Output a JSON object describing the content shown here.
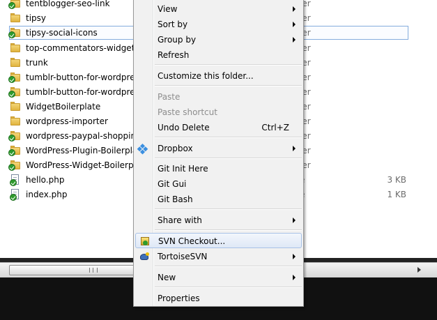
{
  "files": [
    {
      "name": "tentblogger-seo-link",
      "icon": "folder-svn-icon",
      "type": "ler",
      "size": ""
    },
    {
      "name": "tipsy",
      "icon": "folder-icon",
      "type": "ler",
      "size": ""
    },
    {
      "name": "tipsy-social-icons",
      "icon": "folder-svn-icon",
      "type": "ler",
      "size": ""
    },
    {
      "name": "top-commentators-widget",
      "icon": "folder-icon",
      "type": "ler",
      "size": ""
    },
    {
      "name": "trunk",
      "icon": "folder-icon",
      "type": "ler",
      "size": ""
    },
    {
      "name": "tumblr-button-for-wordpress",
      "icon": "folder-svn-icon",
      "type": "ler",
      "size": ""
    },
    {
      "name": "tumblr-button-for-wordpress",
      "icon": "folder-svn-icon",
      "type": "ler",
      "size": ""
    },
    {
      "name": "WidgetBoilerplate",
      "icon": "folder-icon",
      "type": "ler",
      "size": ""
    },
    {
      "name": "wordpress-importer",
      "icon": "folder-icon",
      "type": "ler",
      "size": ""
    },
    {
      "name": "wordpress-paypal-shopping-",
      "icon": "folder-svn-icon",
      "type": "ler",
      "size": ""
    },
    {
      "name": "WordPress-Plugin-Boilerplate",
      "icon": "folder-svn-icon",
      "type": "ler",
      "size": ""
    },
    {
      "name": "WordPress-Widget-Boilerplat",
      "icon": "folder-svn-icon",
      "type": "ler",
      "size": ""
    },
    {
      "name": "hello.php",
      "icon": "php-file-icon",
      "type": "e",
      "size": "3 KB"
    },
    {
      "name": "index.php",
      "icon": "php-file-icon",
      "type": "e",
      "size": "1 KB"
    }
  ],
  "context_menu": {
    "view": "View",
    "sort_by": "Sort by",
    "group_by": "Group by",
    "refresh": "Refresh",
    "customize": "Customize this folder...",
    "paste": "Paste",
    "paste_shortcut": "Paste shortcut",
    "undo_delete": "Undo Delete",
    "undo_shortcut": "Ctrl+Z",
    "dropbox": "Dropbox",
    "git_init": "Git Init Here",
    "git_gui": "Git Gui",
    "git_bash": "Git Bash",
    "share_with": "Share with",
    "svn_checkout": "SVN Checkout...",
    "tortoise_svn": "TortoiseSVN",
    "new": "New",
    "properties": "Properties"
  },
  "colors": {
    "menu_bg": "#f1f1f1",
    "hover_border": "#a8c2e6",
    "selection_border": "#84acdd"
  }
}
